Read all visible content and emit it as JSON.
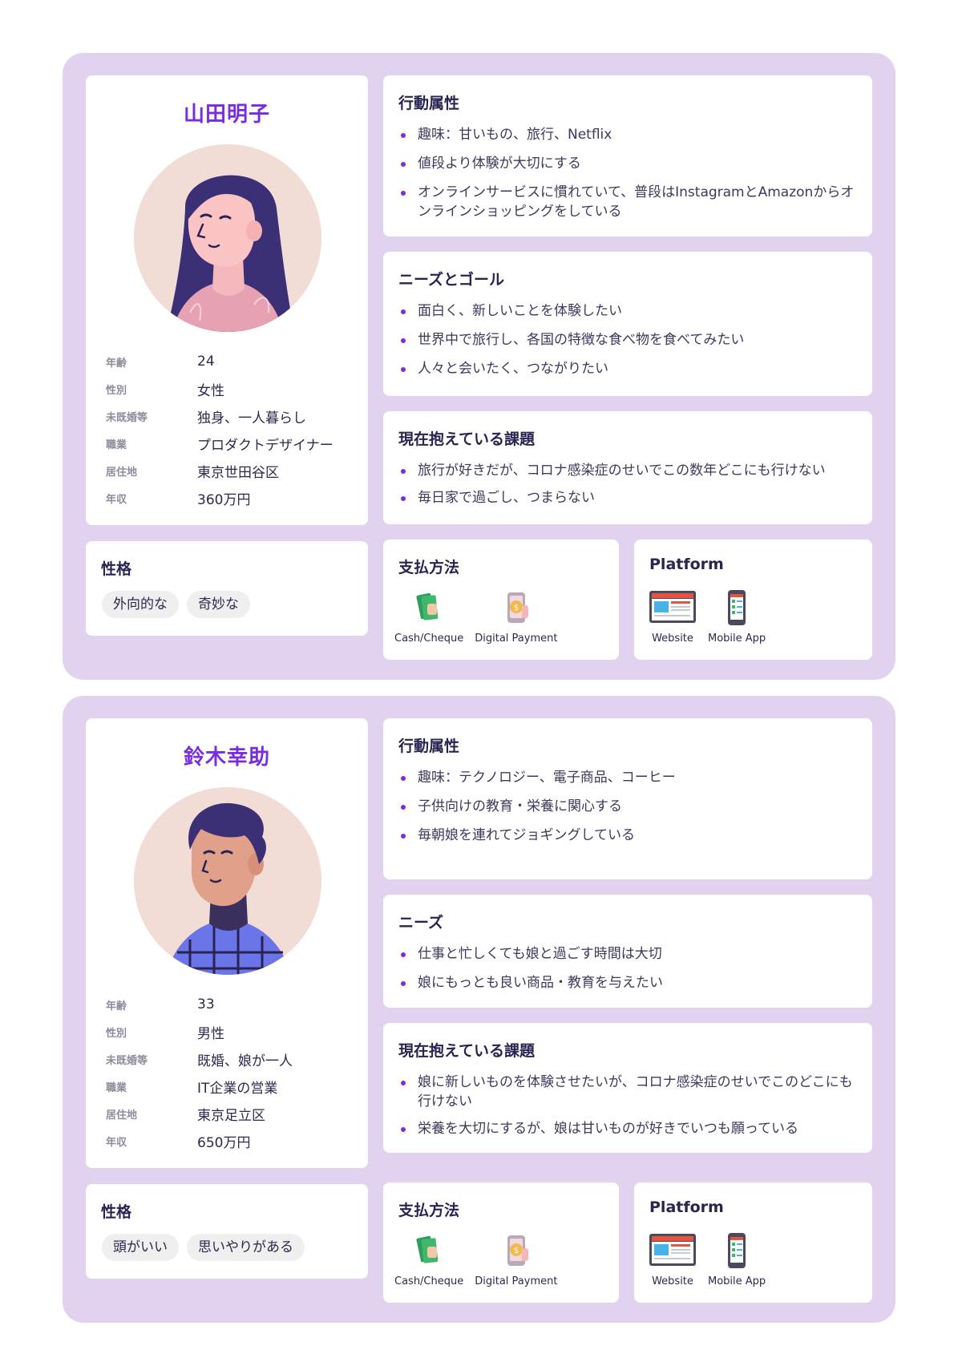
{
  "personas": [
    {
      "name": "山田明子",
      "attributes": [
        {
          "label": "年齢",
          "value": "24"
        },
        {
          "label": "性別",
          "value": "女性"
        },
        {
          "label": "未既婚等",
          "value": "独身、一人暮らし"
        },
        {
          "label": "職業",
          "value": "プロダクトデザイナー"
        },
        {
          "label": "居住地",
          "value": "東京世田谷区"
        },
        {
          "label": "年収",
          "value": "360万円"
        }
      ],
      "personality_title": "性格",
      "traits": [
        "外向的な",
        "奇妙な"
      ],
      "behavior_title": "行動属性",
      "behavior": [
        "趣味：甘いもの、旅行、Netflix",
        "値段より体験が大切にする",
        "オンラインサービスに慣れていて、普段はInstagramとAmazonからオンラインショッピングをしている"
      ],
      "needs_title": "ニーズとゴール",
      "needs": [
        "面白く、新しいことを体験したい",
        "世界中で旅行し、各国の特徴な食べ物を食べてみたい",
        "人々と会いたく、つながりたい"
      ],
      "problems_title": "現在抱えている課題",
      "problems": [
        "旅行が好きだが、コロナ感染症のせいでこの数年どこにも行けない",
        "毎日家で過ごし、つまらない"
      ],
      "payment_title": "支払方法",
      "payment": [
        {
          "label": "Cash/Cheque",
          "icon": "cash-icon"
        },
        {
          "label": "Digital Payment",
          "icon": "digital-payment-icon"
        }
      ],
      "platform_title": "Platform",
      "platform": [
        {
          "label": "Website",
          "icon": "website-icon"
        },
        {
          "label": "Mobile App",
          "icon": "mobile-app-icon"
        }
      ]
    },
    {
      "name": "鈴木幸助",
      "attributes": [
        {
          "label": "年齢",
          "value": "33"
        },
        {
          "label": "性別",
          "value": "男性"
        },
        {
          "label": "未既婚等",
          "value": "既婚、娘が一人"
        },
        {
          "label": "職業",
          "value": "IT企業の営業"
        },
        {
          "label": "居住地",
          "value": "東京足立区"
        },
        {
          "label": "年収",
          "value": "650万円"
        }
      ],
      "personality_title": "性格",
      "traits": [
        "頭がいい",
        "思いやりがある"
      ],
      "behavior_title": "行動属性",
      "behavior": [
        "趣味：テクノロジー、電子商品、コーヒー",
        "子供向けの教育・栄養に関心する",
        "毎朝娘を連れてジョギングしている"
      ],
      "needs_title": "ニーズ",
      "needs": [
        "仕事と忙しくても娘と過ごす時間は大切",
        "娘にもっとも良い商品・教育を与えたい"
      ],
      "problems_title": "現在抱えている課題",
      "problems": [
        "娘に新しいものを体験させたいが、コロナ感染症のせいでこのどこにも行けない",
        "栄養を大切にするが、娘は甘いものが好きでいつも願っている"
      ],
      "payment_title": "支払方法",
      "payment": [
        {
          "label": "Cash/Cheque",
          "icon": "cash-icon"
        },
        {
          "label": "Digital Payment",
          "icon": "digital-payment-icon"
        }
      ],
      "platform_title": "Platform",
      "platform": [
        {
          "label": "Website",
          "icon": "website-icon"
        },
        {
          "label": "Mobile App",
          "icon": "mobile-app-icon"
        }
      ]
    }
  ],
  "colors": {
    "panel_background": "#e1d3ef",
    "accent": "#7a2ce0",
    "heading": "#272551"
  }
}
